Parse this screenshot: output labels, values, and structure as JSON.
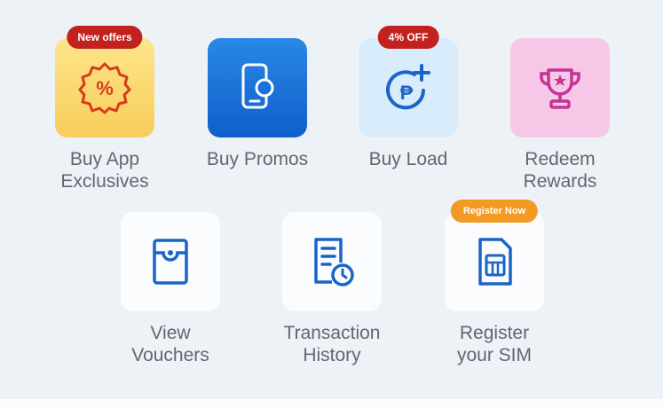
{
  "colors": {
    "background": "#edf2f6",
    "label": "#5f6773",
    "badge_red": "#c2211f",
    "badge_orange": "#f29a23",
    "icon_blue": "#1b64c8"
  },
  "services": {
    "buy_app_exclusives": {
      "label_line1": "Buy App",
      "label_line2": "Exclusives",
      "badge": "New offers",
      "icon": "percent-seal-icon"
    },
    "buy_promos": {
      "label_line1": "Buy Promos",
      "icon": "phone-search-icon"
    },
    "buy_load": {
      "label_line1": "Buy Load",
      "badge": "4% OFF",
      "icon": "peso-plus-icon"
    },
    "redeem_rewards": {
      "label_line1": "Redeem",
      "label_line2": "Rewards",
      "icon": "trophy-icon"
    },
    "view_vouchers": {
      "label_line1": "View",
      "label_line2": "Vouchers",
      "icon": "voucher-icon"
    },
    "transaction_history": {
      "label_line1": "Transaction",
      "label_line2": "History",
      "icon": "history-document-icon"
    },
    "register_sim": {
      "label_line1": "Register",
      "label_line2": "your SIM",
      "badge": "Register Now",
      "icon": "sim-card-icon"
    }
  }
}
